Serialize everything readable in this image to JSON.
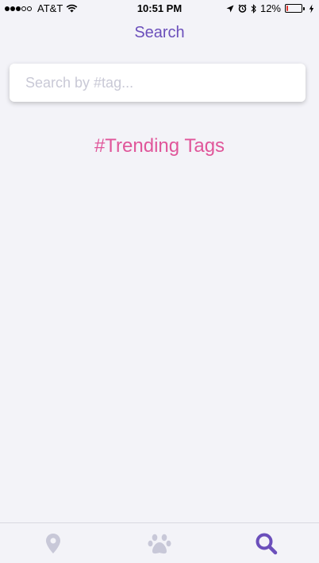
{
  "status_bar": {
    "carrier": "AT&T",
    "time": "10:51 PM",
    "battery_percent": "12%",
    "signal_bars_filled": 3,
    "signal_bars_total": 5,
    "battery_level": 0.12,
    "battery_color": "#e2342b"
  },
  "header": {
    "title": "Search"
  },
  "search": {
    "placeholder": "Search by #tag...",
    "value": ""
  },
  "trending": {
    "title": "#Trending Tags"
  },
  "tab_bar": {
    "tabs": [
      {
        "icon": "map-pin-icon",
        "active": false
      },
      {
        "icon": "paw-icon",
        "active": false
      },
      {
        "icon": "search-icon",
        "active": true
      }
    ],
    "active_color": "#6b4fbb",
    "inactive_color": "#c8c8d8"
  },
  "colors": {
    "background": "#f3f3f8",
    "accent": "#6b4fbb",
    "trending": "#e0569a"
  }
}
